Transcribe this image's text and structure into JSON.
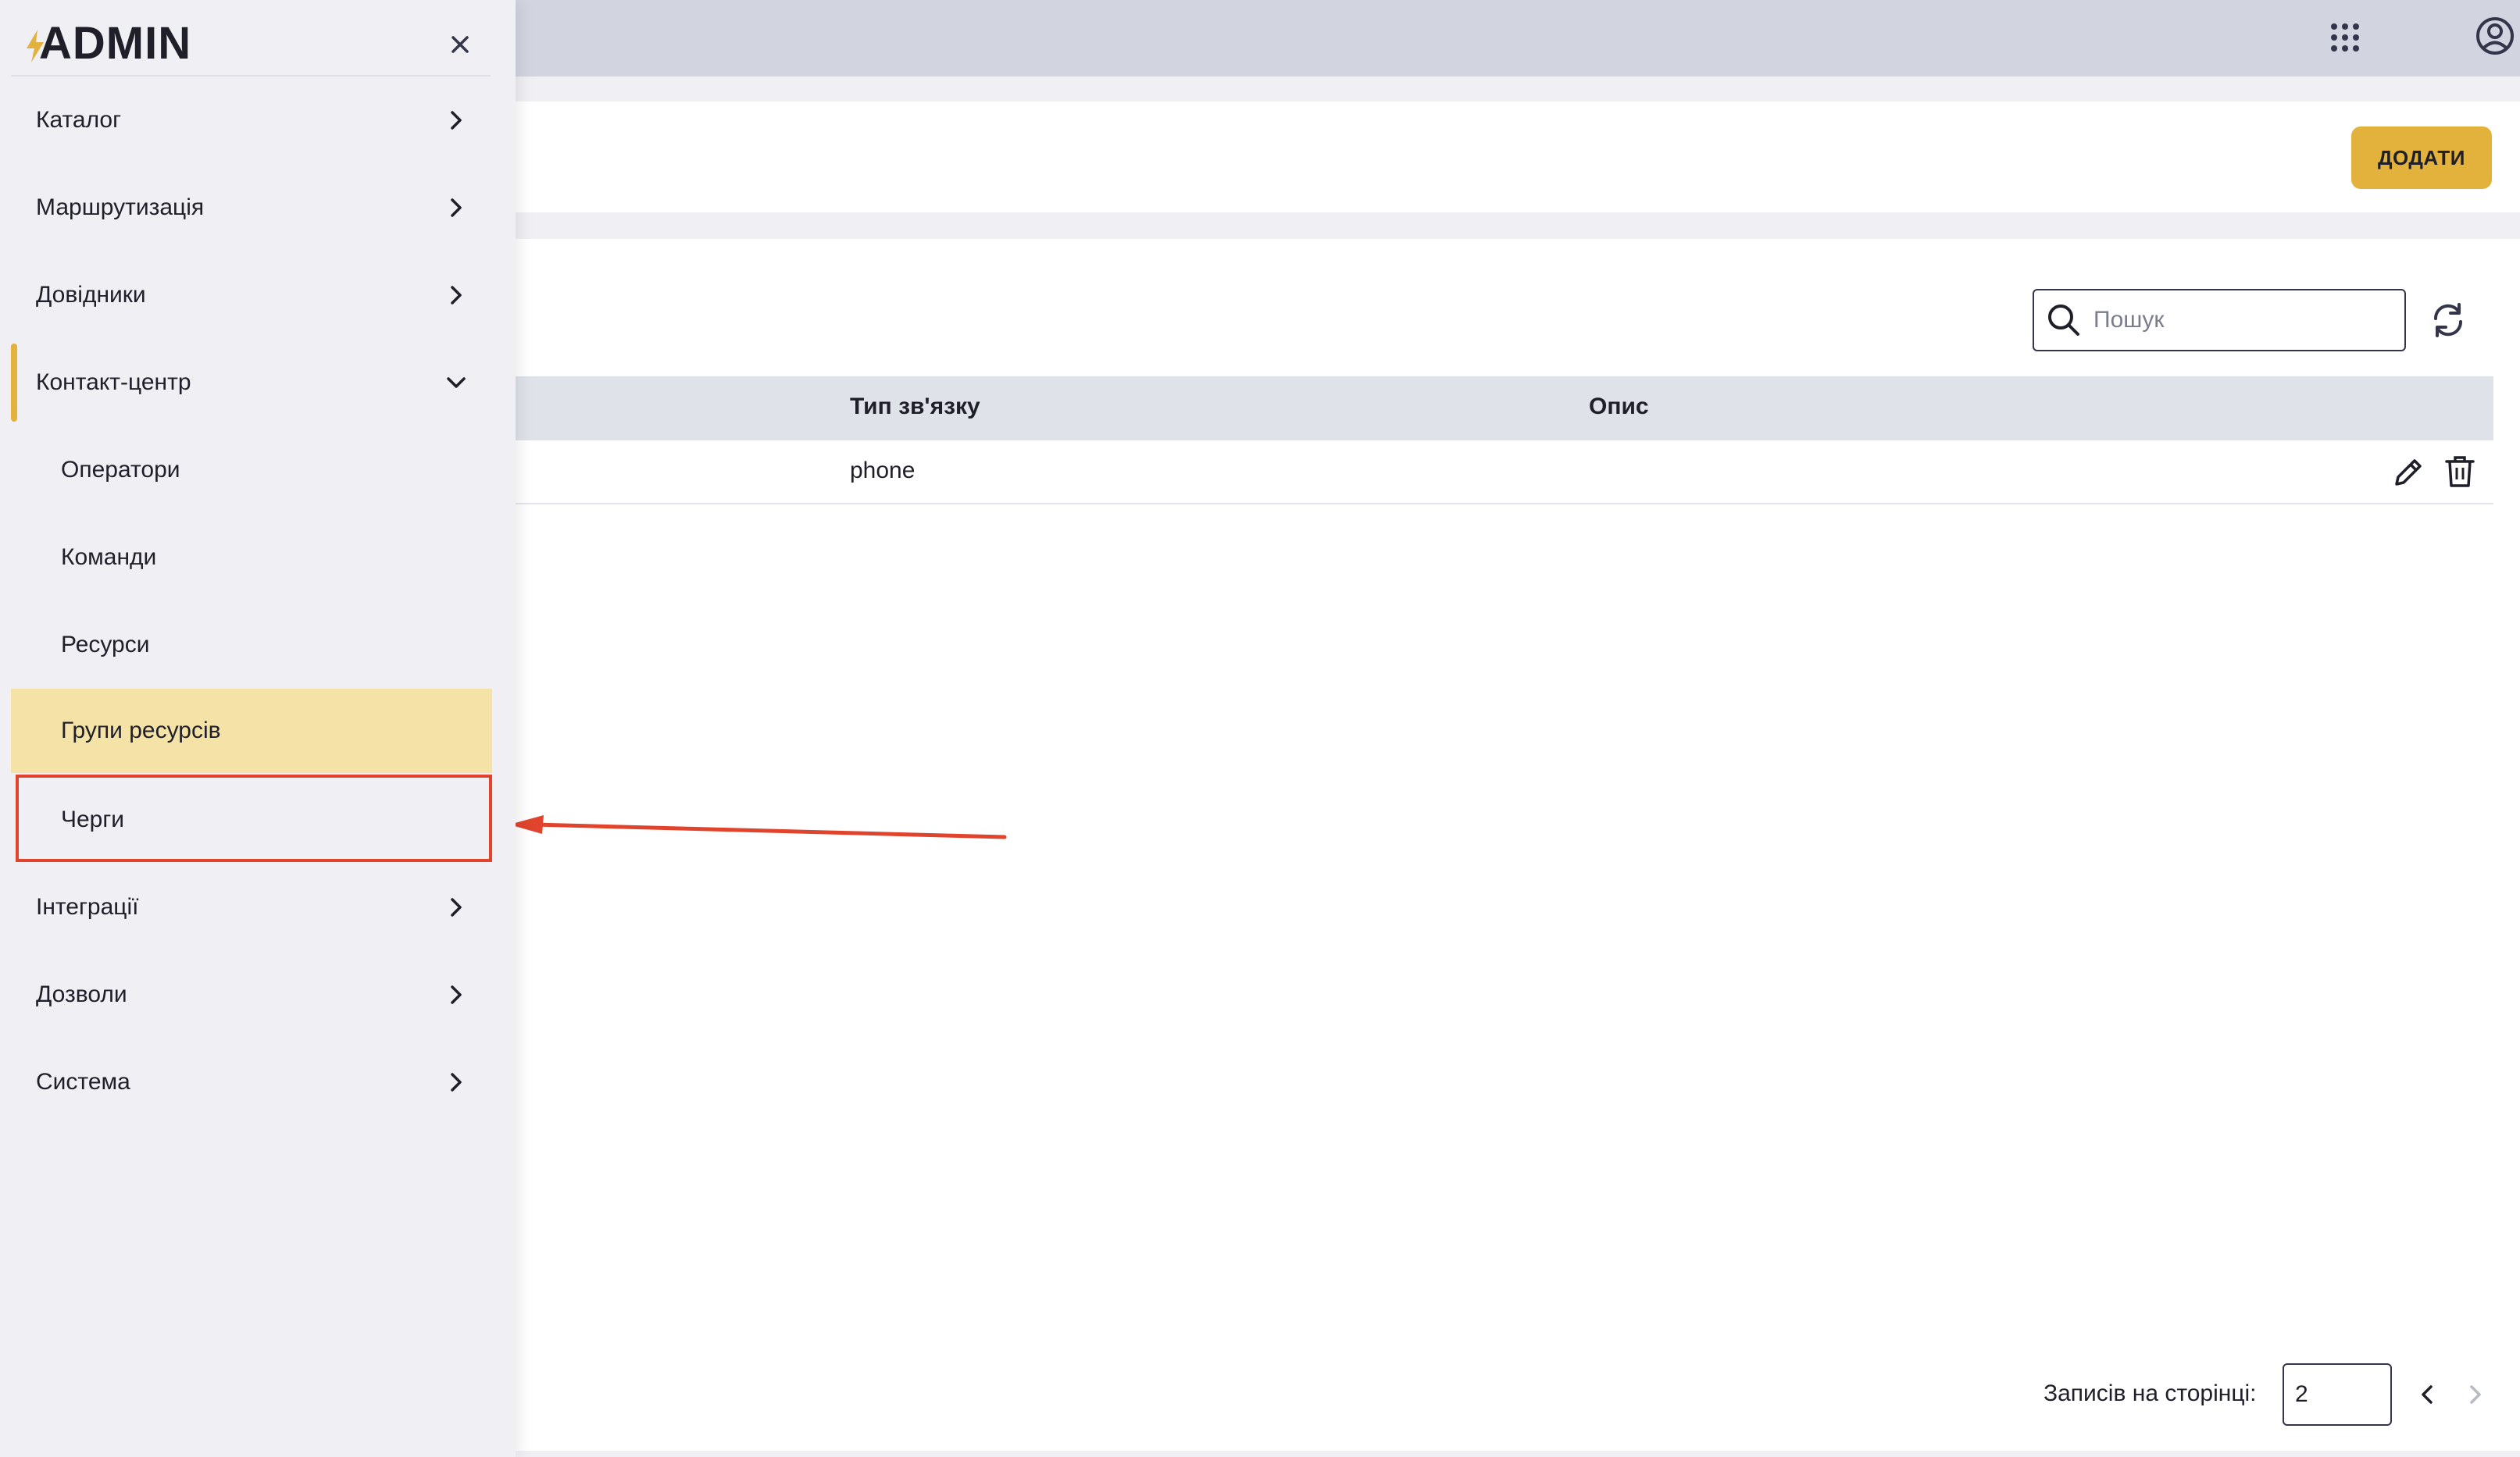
{
  "app": {
    "logo": "ADMIN"
  },
  "toolbar": {
    "add_label": "ДОДАТИ"
  },
  "search": {
    "placeholder": "Пошук",
    "value": ""
  },
  "table": {
    "columns": [
      "Тип зв'язку",
      "Опис"
    ],
    "rows": [
      {
        "type": "phone",
        "description": ""
      }
    ]
  },
  "pagination": {
    "per_page_label": "Записів на сторінці:",
    "per_page_value": "2"
  },
  "sidebar": {
    "items": [
      {
        "label": "Каталог"
      },
      {
        "label": "Маршрутизація"
      },
      {
        "label": "Довідники"
      },
      {
        "label": "Контакт-центр"
      },
      {
        "label": "Оператори"
      },
      {
        "label": "Команди"
      },
      {
        "label": "Ресурси"
      },
      {
        "label": "Групи ресурсів"
      },
      {
        "label": "Черги"
      },
      {
        "label": "Інтеграції"
      },
      {
        "label": "Дозволи"
      },
      {
        "label": "Система"
      }
    ]
  },
  "colors": {
    "accent": "#e3b23c",
    "selected_bg": "#f5e2a6",
    "annotation": "#e0442c"
  },
  "icons": [
    "apps-grid-icon",
    "account-circle-icon",
    "search-icon",
    "refresh-icon",
    "edit-icon",
    "delete-icon",
    "chevron-left-icon",
    "chevron-right-icon",
    "close-icon",
    "chevron-down-icon"
  ]
}
